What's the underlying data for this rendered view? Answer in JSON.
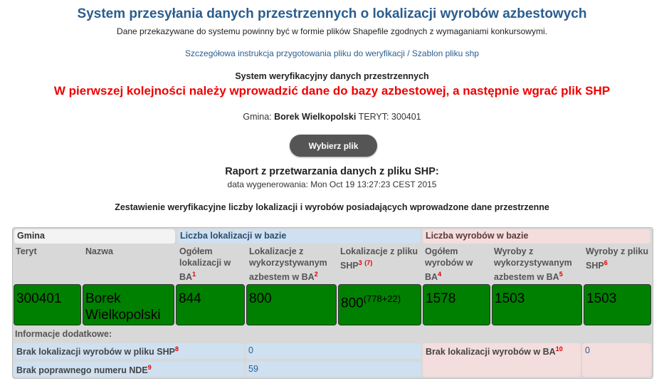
{
  "title": "System przesyłania danych przestrzennych o lokalizacji wyrobów azbestowych",
  "subtitle": "Dane przekazywane do systemu powinny być w formie plików Shapefile zgodnych z wymaganiami konkursowymi.",
  "links": {
    "instruction": "Szczegółowa instrukcja przygotowania pliku do weryfikacji",
    "separator": "/",
    "template": "Szablon pliku shp"
  },
  "system_label": "System weryfikacyjny danych przestrzennych",
  "warning": "W pierwszej kolejności należy wprowadzić dane do bazy azbestowej, a następnie wgrać plik SHP",
  "gmina_line": {
    "label": "Gmina:",
    "name": "Borek Wielkopolski",
    "teryt_label": "TERYT:",
    "teryt": "300401"
  },
  "button_label": "Wybierz plik",
  "report": {
    "title": "Raport z przetwarzania danych z pliku SHP:",
    "generated": "data wygenerowania: Mon Oct 19 13:27:23 CEST 2015",
    "summary_title": "Zestawienie weryfikacyjne liczby lokalizacji i wyrobów posiadających wprowadzone dane przestrzenne"
  },
  "table": {
    "group_gmina": "Gmina",
    "group_lok": "Liczba lokalizacji w bazie",
    "group_wyr": "Liczba wyrobów w bazie",
    "col_teryt": "Teryt",
    "col_nazwa": "Nazwa",
    "col_ogolem_lok": "Ogółem lokalizacji w BA",
    "col_ogolem_lok_sup": "1",
    "col_lok_wyk": "Lokalizacje z wykorzystywanym azbestem w BA",
    "col_lok_wyk_sup": "2",
    "col_lok_shp": "Lokalizacje z pliku SHP",
    "col_lok_shp_sup": "3",
    "col_lok_shp_sup2": "(7)",
    "col_ogolem_wyr": "Ogółem wyrobów w BA",
    "col_ogolem_wyr_sup": "4",
    "col_wyr_wyk": "Wyroby z wykorzystywanym azbestem w BA",
    "col_wyr_wyk_sup": "5",
    "col_wyr_shp": "Wyroby z pliku SHP",
    "col_wyr_shp_sup": "6",
    "row": {
      "teryt": "300401",
      "nazwa": "Borek Wielkopolski",
      "ogolem_lok": "844",
      "lok_wyk": "800",
      "lok_shp": "800",
      "lok_shp_detail": "(778+22)",
      "ogolem_wyr": "1578",
      "wyr_wyk": "1503",
      "wyr_shp": "1503"
    },
    "info_title": "Informacje dodatkowe:",
    "brak_lok_shp": "Brak lokalizacji wyrobów w pliku SHP",
    "brak_lok_shp_sup": "8",
    "brak_lok_shp_val": "0",
    "brak_nde": "Brak poprawnego numeru NDE",
    "brak_nde_sup": "9",
    "brak_nde_val": "59",
    "brak_lok_ba": "Brak lokalizacji wyrobów w BA",
    "brak_lok_ba_sup": "10",
    "brak_lok_ba_val": "0"
  }
}
